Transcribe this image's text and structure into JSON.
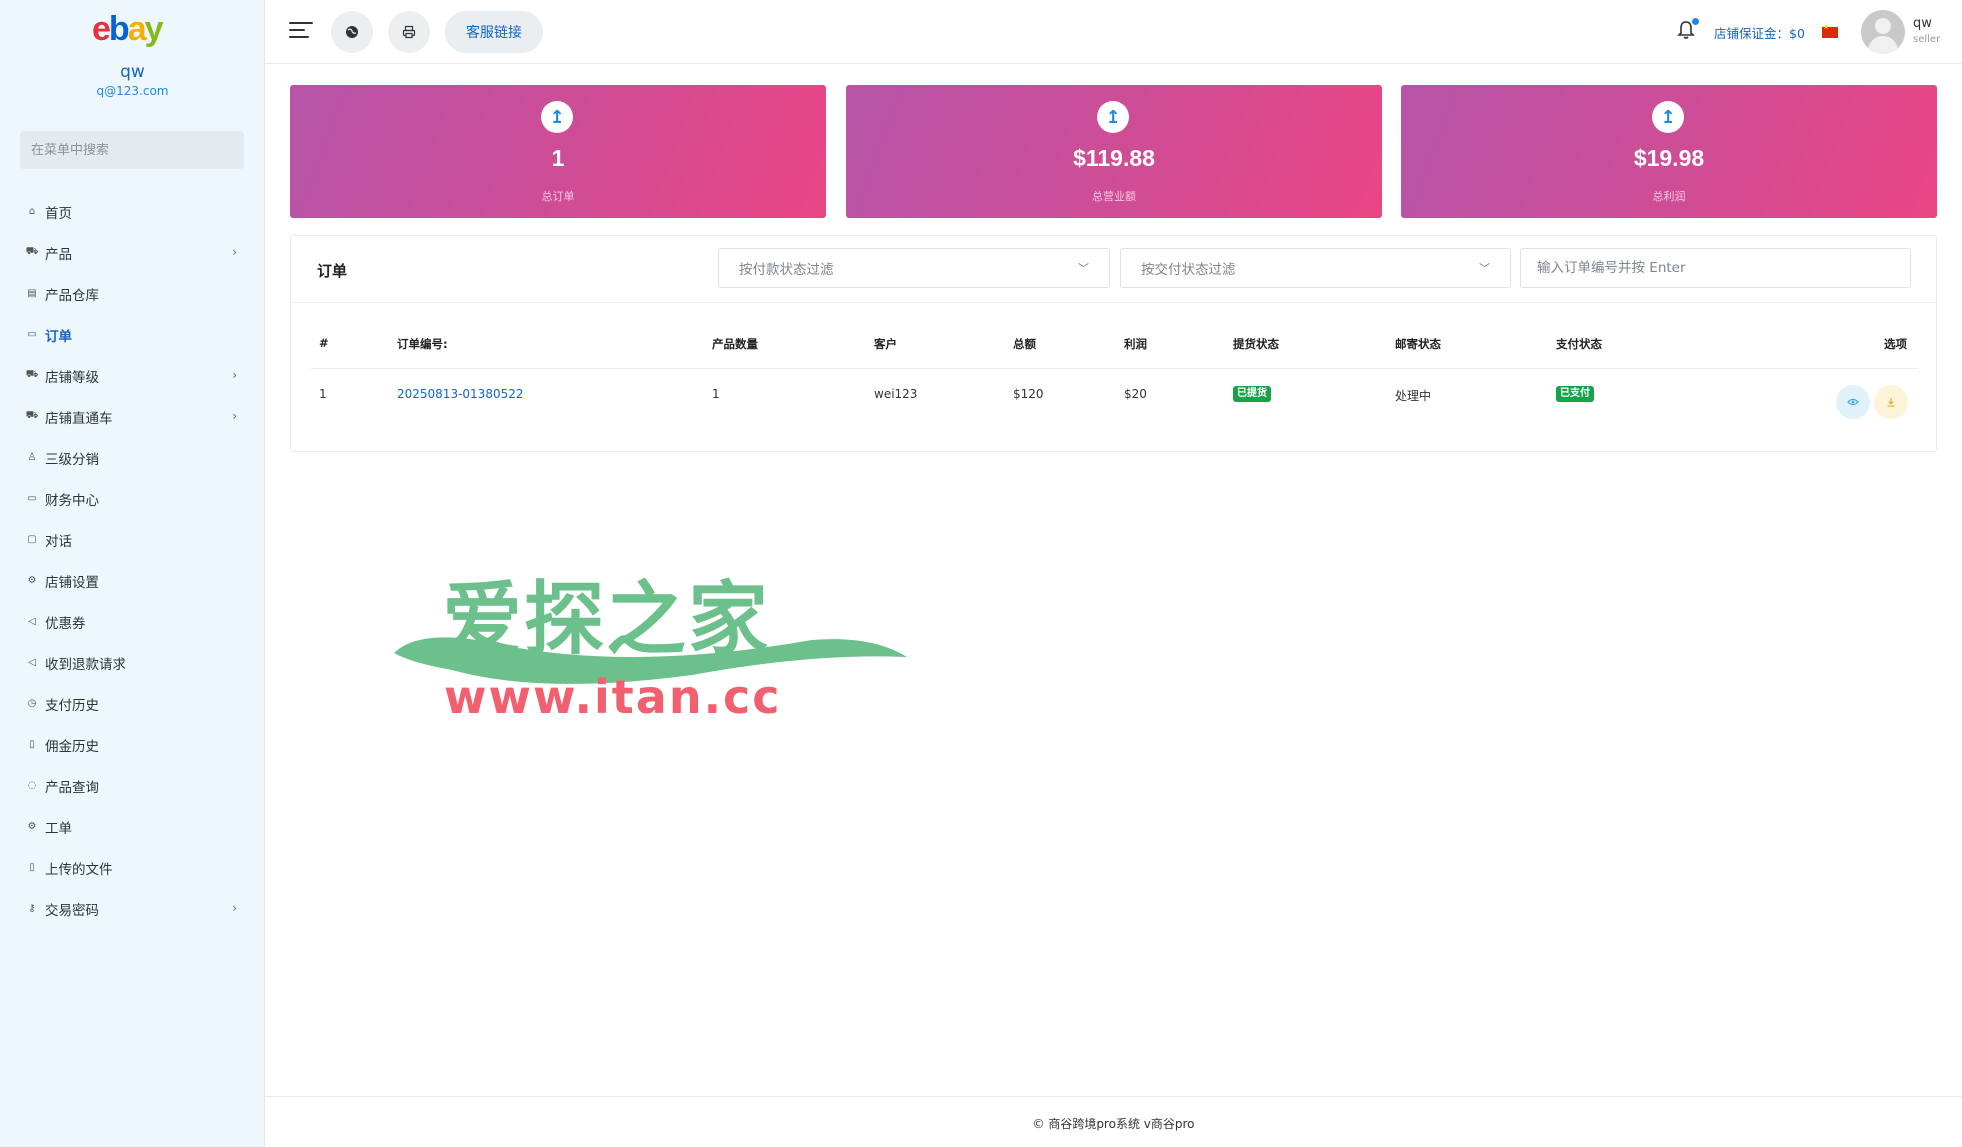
{
  "sidebar": {
    "logo": {
      "letters": [
        "e",
        "b",
        "a",
        "y"
      ],
      "colors": [
        "#e53238",
        "#0064d2",
        "#f5af02",
        "#86b817"
      ]
    },
    "user_name": "qw",
    "user_email": "q@123.com",
    "search_placeholder": "在菜单中搜索",
    "active_color": "#1565c0",
    "items": [
      {
        "label": "首页",
        "icon": "home-icon",
        "has_children": false,
        "active": false
      },
      {
        "label": "产品",
        "icon": "cart-icon",
        "has_children": true,
        "active": false
      },
      {
        "label": "产品仓库",
        "icon": "warehouse-icon",
        "has_children": false,
        "active": false
      },
      {
        "label": "订单",
        "icon": "order-icon",
        "has_children": false,
        "active": true
      },
      {
        "label": "店铺等级",
        "icon": "cart-icon",
        "has_children": true,
        "active": false
      },
      {
        "label": "店铺直通车",
        "icon": "cart-icon",
        "has_children": true,
        "active": false
      },
      {
        "label": "三级分销",
        "icon": "user-icon",
        "has_children": false,
        "active": false
      },
      {
        "label": "财务中心",
        "icon": "money-icon",
        "has_children": false,
        "active": false
      },
      {
        "label": "对话",
        "icon": "chat-icon",
        "has_children": false,
        "active": false
      },
      {
        "label": "店铺设置",
        "icon": "gear-icon",
        "has_children": false,
        "active": false
      },
      {
        "label": "优惠券",
        "icon": "megaphone-icon",
        "has_children": false,
        "active": false
      },
      {
        "label": "收到退款请求",
        "icon": "rewind-icon",
        "has_children": false,
        "active": false
      },
      {
        "label": "支付历史",
        "icon": "history-icon",
        "has_children": false,
        "active": false
      },
      {
        "label": "佣金历史",
        "icon": "file-icon",
        "has_children": false,
        "active": false
      },
      {
        "label": "产品查询",
        "icon": "help-icon",
        "has_children": false,
        "active": false
      },
      {
        "label": "工单",
        "icon": "gear-icon",
        "has_children": false,
        "active": false
      },
      {
        "label": "上传的文件",
        "icon": "file-icon",
        "has_children": false,
        "active": false
      },
      {
        "label": "交易密码",
        "icon": "key-icon",
        "has_children": true,
        "active": false
      }
    ]
  },
  "header": {
    "customer_service_label": "客服链接",
    "deposit_label": "店铺保证金：$0",
    "user_name": "qw",
    "user_role": "seller",
    "notification_dot_color": "#1e88e5"
  },
  "stats": [
    {
      "value": "1",
      "label": "总订单"
    },
    {
      "value": "$119.88",
      "label": "总营业额"
    },
    {
      "value": "$19.98",
      "label": "总利润"
    }
  ],
  "orders": {
    "title": "订单",
    "payment_filter_placeholder": "按付款状态过滤",
    "delivery_filter_placeholder": "按交付状态过滤",
    "order_search_placeholder": "输入订单编号并按 Enter",
    "columns": [
      "#",
      "订单编号:",
      "产品数量",
      "客户",
      "总额",
      "利润",
      "提货状态",
      "邮寄状态",
      "支付状态",
      "选项"
    ],
    "rows": [
      {
        "index": "1",
        "order_no": "20250813-01380522",
        "quantity": "1",
        "customer": "wei123",
        "total": "$120",
        "profit": "$20",
        "pickup_status": "已提货",
        "shipping_status": "处理中",
        "payment_status": "已支付"
      }
    ],
    "badge_color": "#16a34a"
  },
  "watermark": {
    "title": "爱探之家",
    "url": "www.itan.cc",
    "title_color": "#6cc08b",
    "url_color": "#f0606f"
  },
  "footer": {
    "text": "© 商谷跨境pro系统 v商谷pro"
  }
}
